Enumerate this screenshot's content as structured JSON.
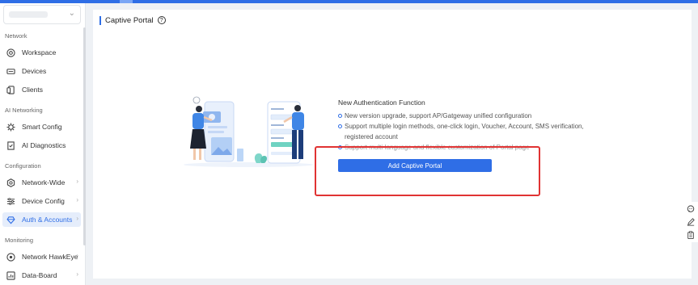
{
  "sidebar": {
    "sections": {
      "network": "Network",
      "ai_networking": "AI Networking",
      "configuration": "Configuration",
      "monitoring": "Monitoring"
    },
    "items": {
      "workspace": "Workspace",
      "devices": "Devices",
      "clients": "Clients",
      "smart_config": "Smart Config",
      "ai_diagnostics": "AI Diagnostics",
      "network_wide": "Network-Wide",
      "device_config": "Device Config",
      "auth_accounts": "Auth & Accounts",
      "network_hawkeye": "Network HawkEye",
      "data_board": "Data-Board"
    },
    "active_item": "Auth & Accounts"
  },
  "main": {
    "title": "Captive Portal",
    "feature": {
      "heading": "New Authentication Function",
      "points": [
        "New version upgrade, support AP/Gatgeway unified configuration",
        "Support multiple login methods, one-click login, Voucher, Account, SMS verification, registered account",
        "Support multi-language and flexible customization of Portal page"
      ]
    },
    "add_button": "Add Captive Portal"
  },
  "colors": {
    "accent": "#2f6ee6",
    "highlight_box": "#e03333",
    "active_bg": "#e5edfb"
  },
  "icons": {
    "workspace": "workspace-icon",
    "devices": "devices-icon",
    "clients": "clients-icon",
    "smart_config": "smart-config-icon",
    "ai_diagnostics": "ai-diagnostics-icon",
    "network_wide": "network-wide-icon",
    "device_config": "device-config-icon",
    "auth_accounts": "auth-accounts-icon",
    "network_hawkeye": "hawkeye-icon",
    "data_board": "data-board-icon",
    "help": "help-icon",
    "right_tools": [
      "chat-icon",
      "edit-icon",
      "clipboard-icon"
    ]
  }
}
